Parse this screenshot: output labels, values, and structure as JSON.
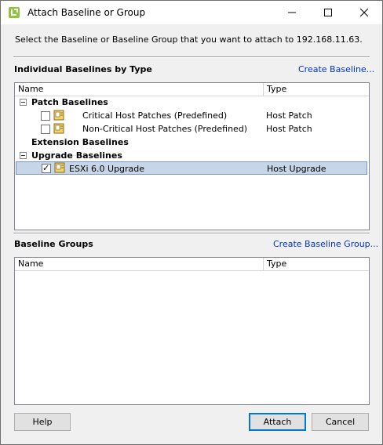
{
  "window": {
    "title": "Attach Baseline or Group"
  },
  "instructions": "Select the Baseline or Baseline Group that you want to attach to 192.168.11.63.",
  "baselines": {
    "title": "Individual Baselines by Type",
    "create_link": "Create Baseline...",
    "columns": {
      "name": "Name",
      "type": "Type"
    },
    "groups": [
      {
        "label": "Patch Baselines",
        "items": [
          {
            "name": "Critical Host Patches (Predefined)",
            "type": "Host Patch",
            "checked": false
          },
          {
            "name": "Non-Critical Host Patches (Predefined)",
            "type": "Host Patch",
            "checked": false
          }
        ]
      },
      {
        "label": "Extension Baselines",
        "items": []
      },
      {
        "label": "Upgrade Baselines",
        "items": [
          {
            "name": "ESXi 6.0 Upgrade",
            "type": "Host Upgrade",
            "checked": true,
            "selected": true
          }
        ]
      }
    ]
  },
  "baseline_groups": {
    "title": "Baseline Groups",
    "create_link": "Create Baseline Group...",
    "columns": {
      "name": "Name",
      "type": "Type"
    }
  },
  "buttons": {
    "help": "Help",
    "attach": "Attach",
    "cancel": "Cancel"
  }
}
